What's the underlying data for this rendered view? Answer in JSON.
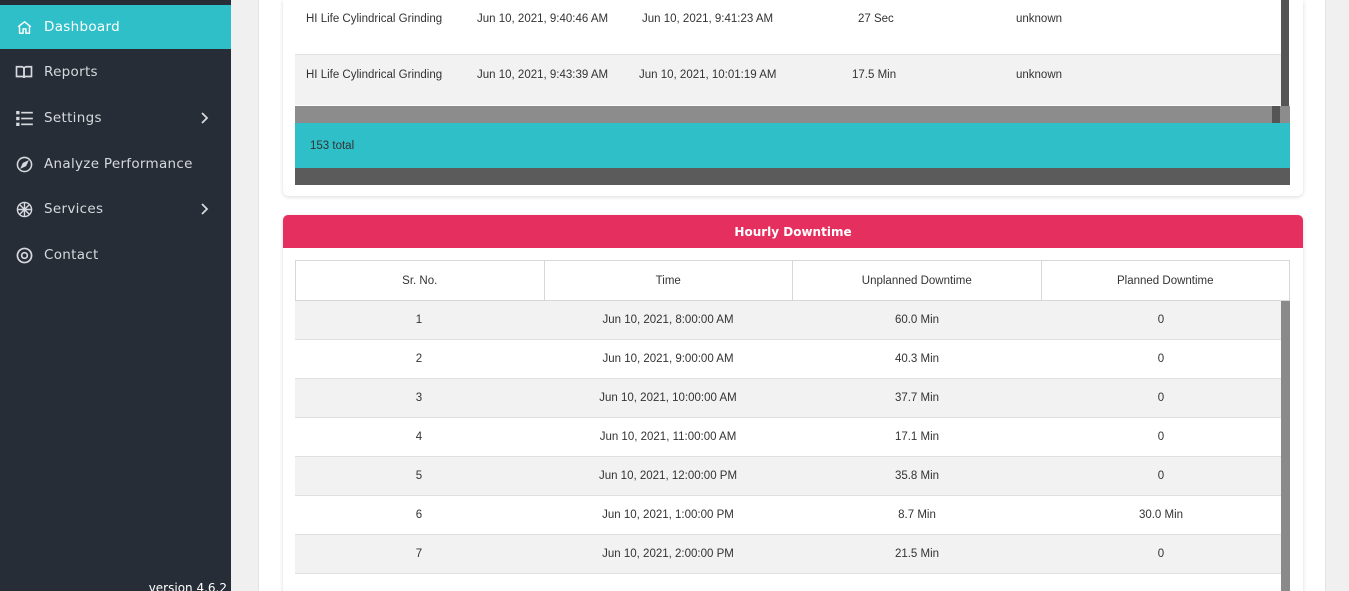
{
  "sidebar": {
    "items": [
      {
        "label": "Dashboard",
        "icon": "home-icon",
        "active": true
      },
      {
        "label": "Reports",
        "icon": "book-icon"
      },
      {
        "label": "Settings",
        "icon": "list-icon",
        "has_submenu": true
      },
      {
        "label": "Analyze Performance",
        "icon": "compass-icon"
      },
      {
        "label": "Services",
        "icon": "services-icon",
        "has_submenu": true
      },
      {
        "label": "Contact",
        "icon": "lifebuoy-icon"
      }
    ],
    "version": "version 4.6.2"
  },
  "top_table": {
    "rows": [
      {
        "machine": "HI Life Cylindrical Grinding",
        "start": "Jun 10, 2021, 9:40:46 AM",
        "end": "Jun 10, 2021, 9:41:23 AM",
        "duration": "27 Sec",
        "reason": "unknown"
      },
      {
        "machine": "HI Life Cylindrical Grinding",
        "start": "Jun 10, 2021, 9:43:39 AM",
        "end": "Jun 10, 2021, 10:01:19 AM",
        "duration": "17.5 Min",
        "reason": "unknown"
      }
    ],
    "total": "153 total"
  },
  "hourly": {
    "title": "Hourly Downtime",
    "columns": [
      "Sr. No.",
      "Time",
      "Unplanned Downtime",
      "Planned Downtime"
    ],
    "rows": [
      {
        "sr": "1",
        "time": "Jun 10, 2021, 8:00:00 AM",
        "unplanned": "60.0 Min",
        "planned": "0"
      },
      {
        "sr": "2",
        "time": "Jun 10, 2021, 9:00:00 AM",
        "unplanned": "40.3 Min",
        "planned": "0"
      },
      {
        "sr": "3",
        "time": "Jun 10, 2021, 10:00:00 AM",
        "unplanned": "37.7 Min",
        "planned": "0"
      },
      {
        "sr": "4",
        "time": "Jun 10, 2021, 11:00:00 AM",
        "unplanned": "17.1 Min",
        "planned": "0"
      },
      {
        "sr": "5",
        "time": "Jun 10, 2021, 12:00:00 PM",
        "unplanned": "35.8 Min",
        "planned": "0"
      },
      {
        "sr": "6",
        "time": "Jun 10, 2021, 1:00:00 PM",
        "unplanned": "8.7 Min",
        "planned": "30.0 Min"
      },
      {
        "sr": "7",
        "time": "Jun 10, 2021, 2:00:00 PM",
        "unplanned": "21.5 Min",
        "planned": "0"
      }
    ]
  },
  "colors": {
    "sidebar_bg": "#262d37",
    "accent_teal": "#2ebfc8",
    "header_pink": "#e5305f"
  }
}
